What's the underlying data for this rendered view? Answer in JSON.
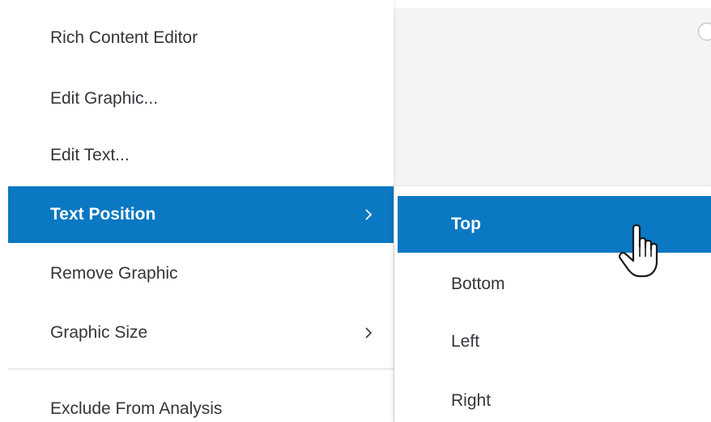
{
  "menu": {
    "items": [
      {
        "label": "Rich Content Editor"
      },
      {
        "label": "Edit Graphic..."
      },
      {
        "label": "Edit Text..."
      },
      {
        "label": "Text Position",
        "active": true,
        "has_submenu": true
      },
      {
        "label": "Remove Graphic"
      },
      {
        "label": "Graphic Size",
        "has_submenu": true
      },
      {
        "label": "Exclude From Analysis"
      }
    ]
  },
  "submenu": {
    "items": [
      {
        "label": "Top",
        "active": true
      },
      {
        "label": "Bottom"
      },
      {
        "label": "Left"
      },
      {
        "label": "Right"
      }
    ]
  },
  "colors": {
    "accent": "#0a78c2",
    "text": "#32363a",
    "panel": "#f2f4f6"
  },
  "icons": {
    "chevron": "chevron-right-icon",
    "cursor": "hand-pointer-icon"
  }
}
